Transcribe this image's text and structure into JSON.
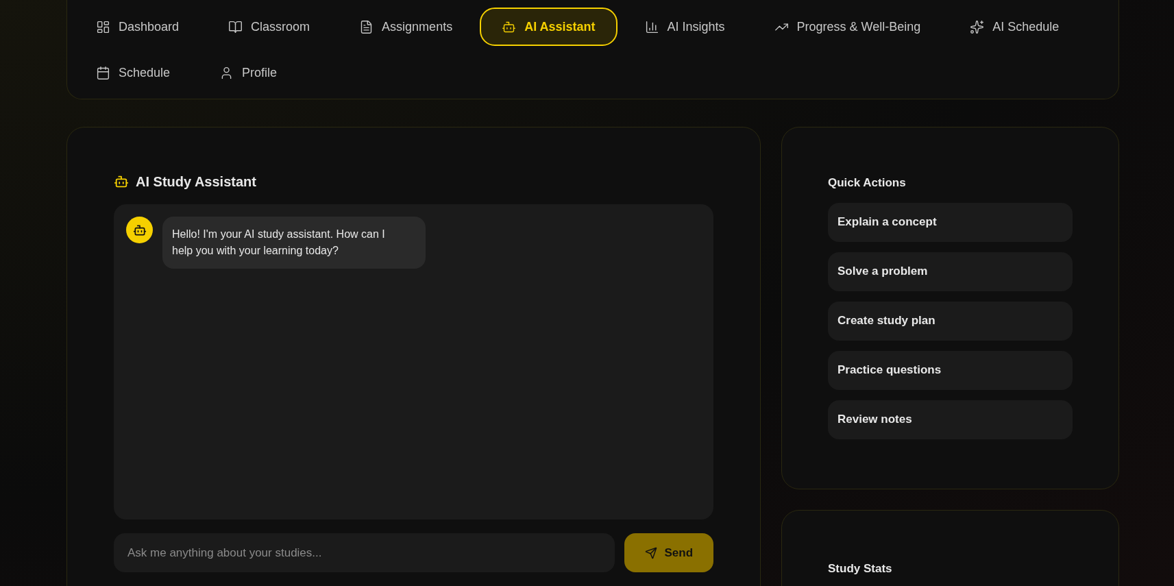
{
  "nav": [
    {
      "label": "Dashboard",
      "selected": false
    },
    {
      "label": "Classroom",
      "selected": false
    },
    {
      "label": "Assignments",
      "selected": false
    },
    {
      "label": "AI Assistant",
      "selected": true
    },
    {
      "label": "AI Insights",
      "selected": false
    },
    {
      "label": "Progress & Well-Being",
      "selected": false
    },
    {
      "label": "AI Schedule",
      "selected": false
    },
    {
      "label": "Schedule",
      "selected": false
    },
    {
      "label": "Profile",
      "selected": false
    }
  ],
  "chat": {
    "title": "AI Study Assistant",
    "messages": [
      {
        "text": "Hello! I'm your AI study assistant. How can I help you with your learning today?"
      }
    ],
    "input": {
      "placeholder": "Ask me anything about your studies..."
    },
    "send_button": "Send"
  },
  "quick_actions": {
    "title": "Quick Actions",
    "items": [
      "Explain a concept",
      "Solve a problem",
      "Create study plan",
      "Practice questions",
      "Review notes"
    ]
  },
  "study_stats": {
    "title": "Study Stats"
  }
}
